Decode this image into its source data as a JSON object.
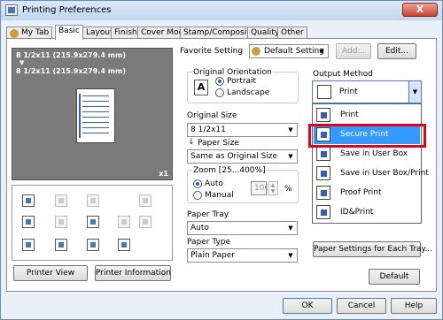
{
  "window": {
    "title": "Printing Preferences",
    "close_label": "X"
  },
  "tabs": [
    {
      "label": "My Tab"
    },
    {
      "label": "Basic"
    },
    {
      "label": "Layout"
    },
    {
      "label": "Finish"
    },
    {
      "label": "Cover Mode"
    },
    {
      "label": "Stamp/Composition"
    },
    {
      "label": "Quality"
    },
    {
      "label": "Other"
    }
  ],
  "preview": {
    "line1": "8 1/2x11 (215.9x279.4 mm)",
    "arrow": "▼",
    "line2": "8 1/2x11 (215.9x279.4 mm)",
    "copies": "x1"
  },
  "left_buttons": {
    "printer_view": "Printer View",
    "printer_info": "Printer Information"
  },
  "favorite": {
    "label": "Favorite Setting",
    "value": "Default Setting",
    "add": "Add...",
    "edit": "Edit..."
  },
  "orientation": {
    "group_label": "Original Orientation",
    "portrait": "Portrait",
    "landscape": "Landscape",
    "selected": "Portrait"
  },
  "original_size": {
    "label": "Original Size",
    "value": "8 1/2x11"
  },
  "paper_size": {
    "label": "Paper Size",
    "value": "Same as Original Size"
  },
  "zoom": {
    "group_label": "Zoom [25...400%]",
    "auto": "Auto",
    "manual": "Manual",
    "value": "100",
    "unit": "%",
    "selected": "Auto"
  },
  "paper_tray": {
    "label": "Paper Tray",
    "value": "Auto"
  },
  "paper_type": {
    "label": "Paper Type",
    "value": "Plain Paper"
  },
  "output_method": {
    "label": "Output Method",
    "selected": "Print",
    "items": [
      {
        "label": "Print"
      },
      {
        "label": "Secure Print"
      },
      {
        "label": "Save in User Box"
      },
      {
        "label": "Save in User Box/Print"
      },
      {
        "label": "Proof Print"
      },
      {
        "label": "ID&Print"
      }
    ],
    "highlighted": "Secure Print"
  },
  "paper_settings_button": "Paper Settings for Each Tray...",
  "default_button": "Default",
  "footer": {
    "ok": "OK",
    "cancel": "Cancel",
    "help": "Help"
  },
  "colors": {
    "highlight": "#3399ff",
    "callout": "#e0001a"
  }
}
